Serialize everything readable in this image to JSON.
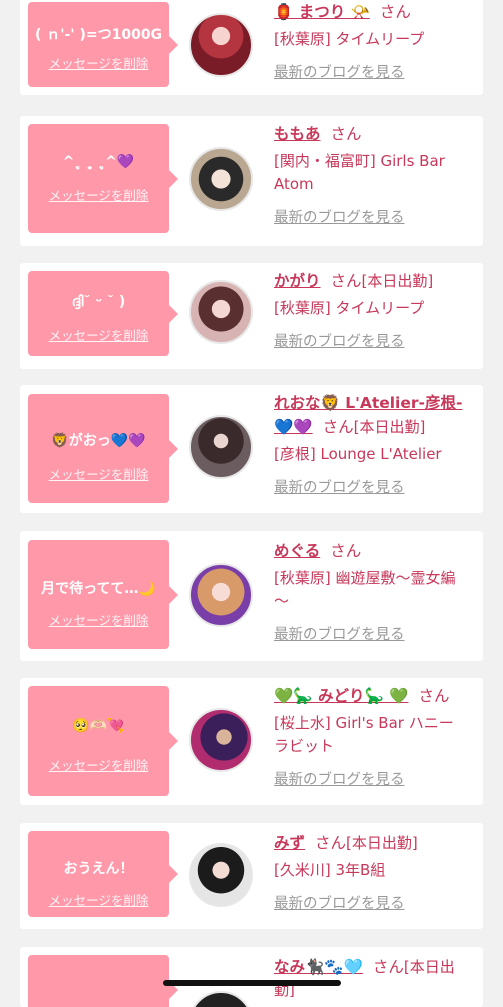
{
  "delete_label": "メッセージを削除",
  "blog_label": "最新のブログを見る",
  "san_label": "さん",
  "working_label": "[本日出勤]",
  "colors": {
    "accent": "#c8385a",
    "bubble": "#ff99aa",
    "background": "#f1f1f1"
  },
  "entries": [
    {
      "message": "( ｎ'-' )=つ1000G",
      "name": "🏮 まつり 📯",
      "shop_lines": [
        "[秋葉原] タイムリープ"
      ]
    },
    {
      "message": "^ˎ̥ ˍ̥ ˎ̥^💜",
      "name": "ももあ",
      "shop_lines": [
        "[関内・福富町] Girls Bar",
        "Atom"
      ]
    },
    {
      "message": "ദ്ദി˘ ᵕ ˘ )",
      "name": "かがり",
      "working": "[本日出勤]",
      "shop_lines": [
        "[秋葉原] タイムリープ"
      ]
    },
    {
      "message": "🦁がおっ💙💜",
      "name_lines": [
        "れおな🦁 L'Atelier-彦根-",
        "💙💜"
      ],
      "working": "[本日出勤]",
      "shop_lines": [
        "[彦根] Lounge L'Atelier"
      ]
    },
    {
      "message": "月で待ってて…🌙",
      "name": "めぐる",
      "shop_lines": [
        "[秋葉原] 幽遊屋敷〜霊女編",
        "〜"
      ]
    },
    {
      "message": "🥺🫶🏻💘",
      "name": "💚🦕 みどり🦕 💚",
      "shop_lines": [
        "[桜上水] Girl's Bar ハニー",
        "ラビット"
      ]
    },
    {
      "message": "おうえん！",
      "name": "みず",
      "working": "[本日出勤]",
      "shop_lines": [
        "[久米川] 3年B組"
      ]
    },
    {
      "message": "",
      "name": "なみ🐈‍⬛🐾🩵",
      "working_partial": "[本日出",
      "working_partial_2": "勤]"
    }
  ]
}
